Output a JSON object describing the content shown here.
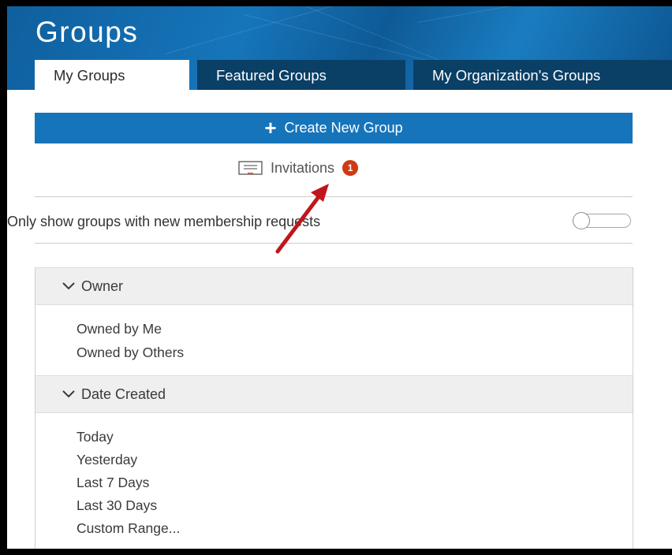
{
  "header": {
    "title": "Groups",
    "tabs": [
      {
        "label": "My Groups",
        "active": true
      },
      {
        "label": "Featured Groups",
        "active": false
      },
      {
        "label": "My Organization's Groups",
        "active": false
      }
    ]
  },
  "actions": {
    "create_label": "Create New Group",
    "invitations_label": "Invitations",
    "invitations_count": "1"
  },
  "filter": {
    "toggle_label": "Only show groups with new membership requests",
    "toggle_on": false
  },
  "owner": {
    "title": "Owner",
    "items": [
      "Owned by Me",
      "Owned by Others"
    ]
  },
  "date_created": {
    "title": "Date Created",
    "items": [
      "Today",
      "Yesterday",
      "Last 7 Days",
      "Last 30 Days",
      "Custom Range..."
    ]
  },
  "colors": {
    "accent": "#1674ba",
    "tab_inactive": "#0a3f66",
    "badge": "#cf3a12",
    "annotation_arrow": "#c0161b"
  },
  "icons": [
    "plus-icon",
    "invitation-icon",
    "chevron-down-icon"
  ]
}
